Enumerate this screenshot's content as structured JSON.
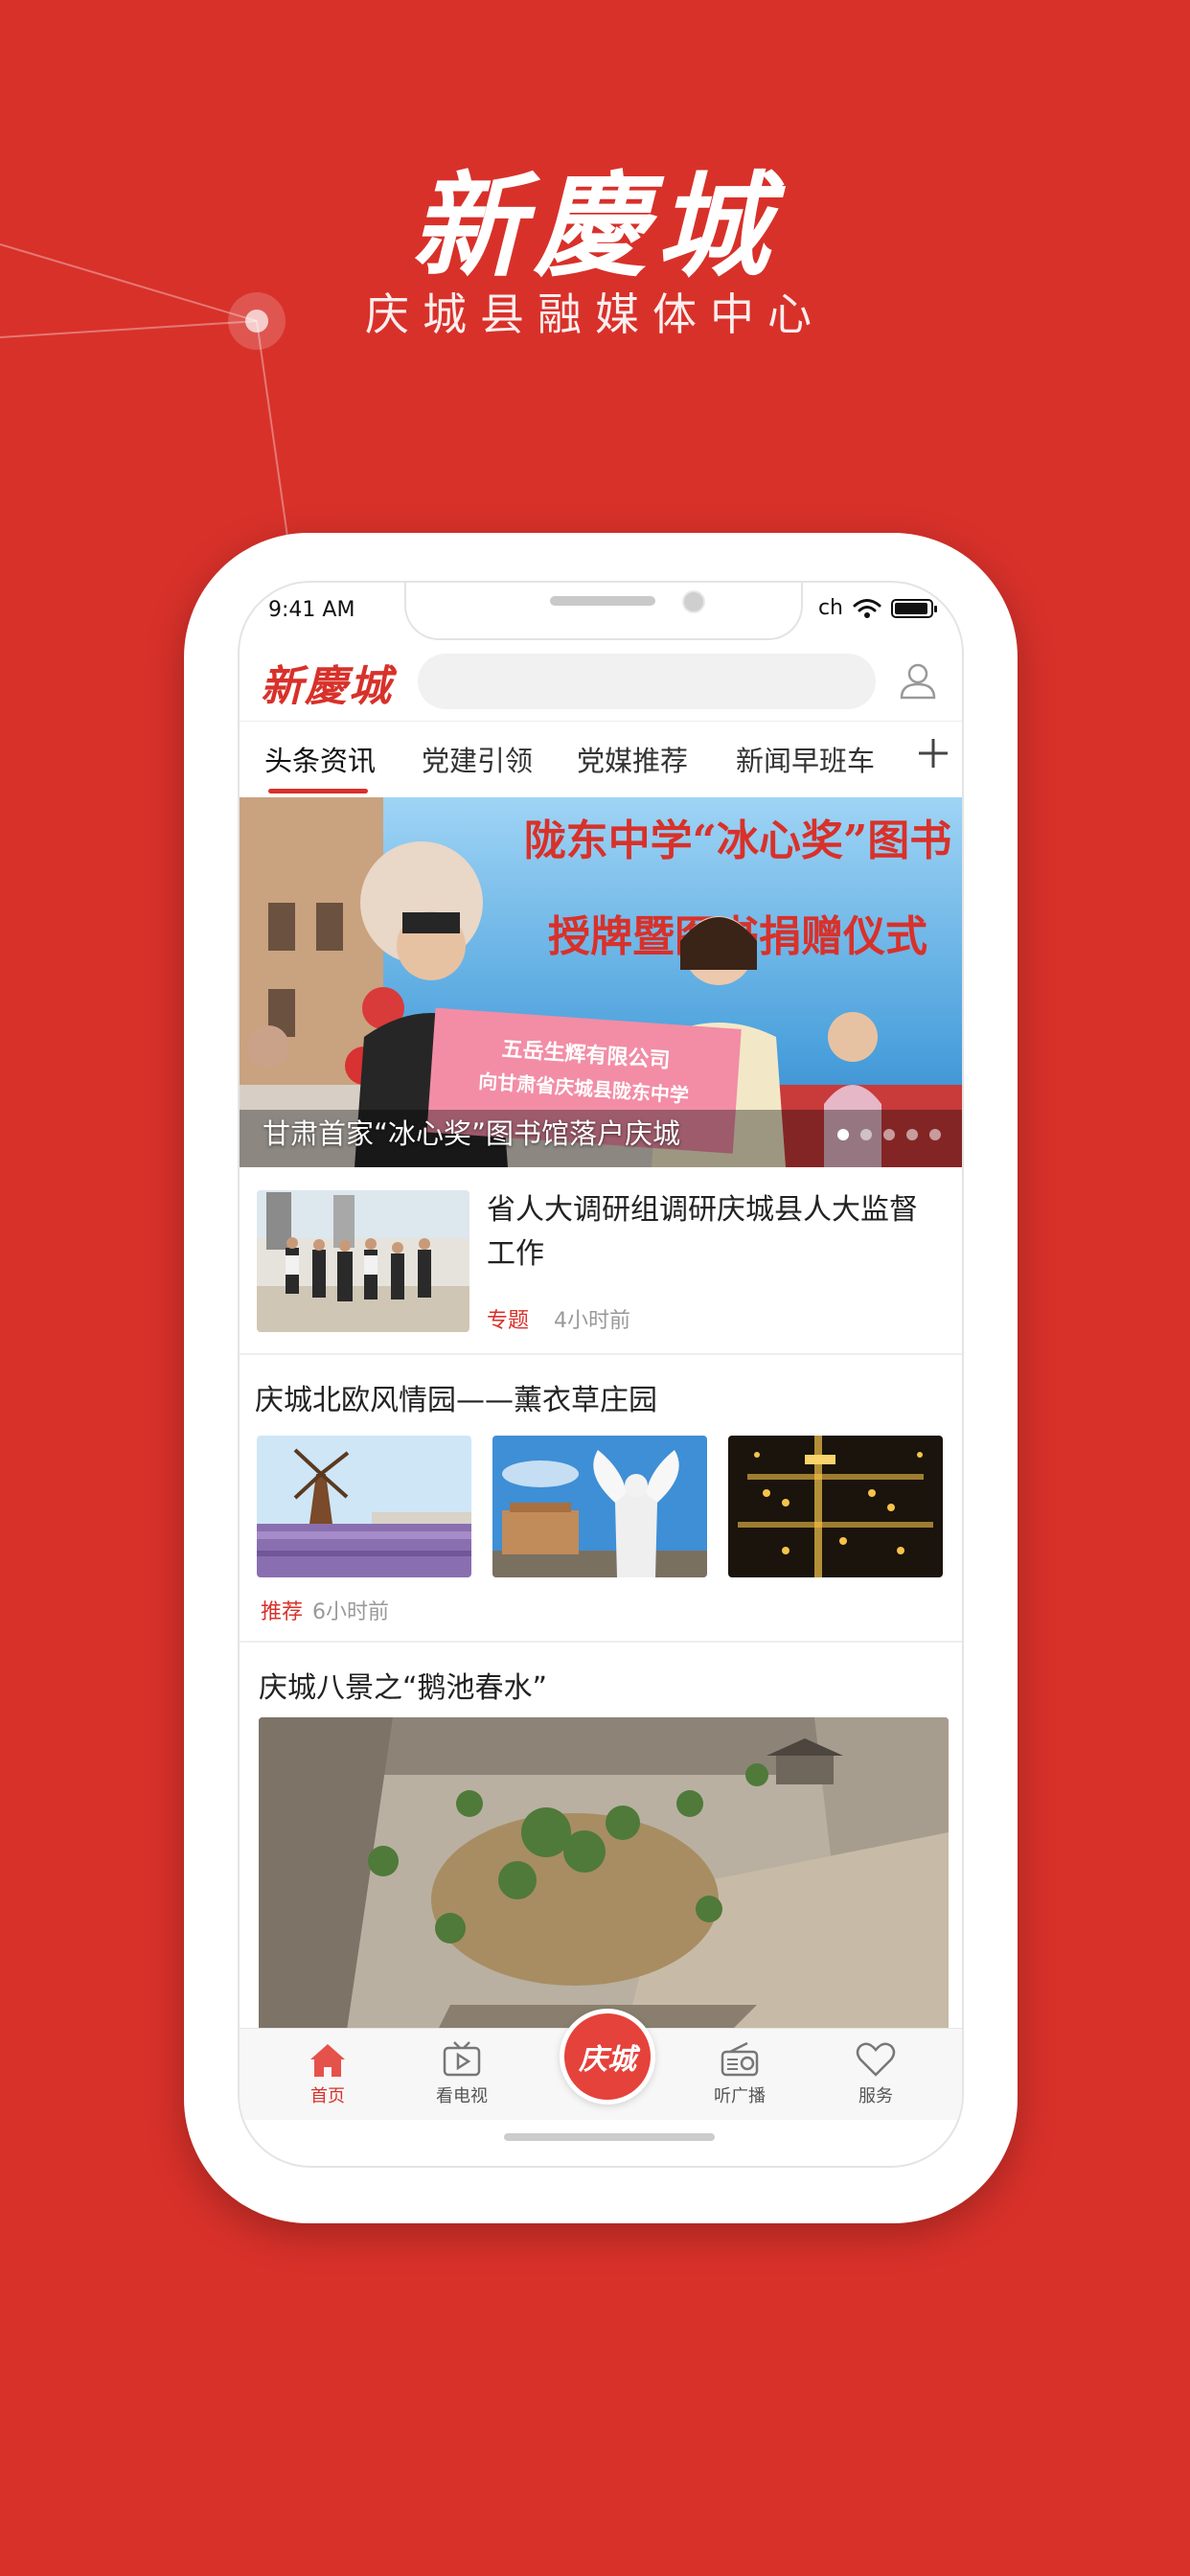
{
  "promo": {
    "logo_text": "新慶城",
    "subtitle": "庆城县融媒体中心"
  },
  "status_bar": {
    "time": "9:41 AM",
    "carrier": "ch"
  },
  "header": {
    "logo_text": "新慶城",
    "search_placeholder": ""
  },
  "tabs": [
    {
      "label": "头条资讯",
      "active": true
    },
    {
      "label": "党建引领",
      "active": false
    },
    {
      "label": "党媒推荐",
      "active": false
    },
    {
      "label": "新闻早班车",
      "active": false
    }
  ],
  "banner": {
    "caption": "甘肃首家“冰心奖”图书馆落户庆城",
    "image_text": {
      "line1": "陇东中学“冰心奖”图书",
      "line2": "授牌暨图书捐赠仪式",
      "sign1": "五岳生辉有限公司",
      "sign2": "向甘肃省庆城县陇东中学"
    },
    "dot_count": 5,
    "active_dot": 0
  },
  "news": [
    {
      "title": "省人大调研组调研庆城县人大监督工作",
      "tag": "专题",
      "time": "4小时前"
    },
    {
      "title": "庆城北欧风情园——薰衣草庄园",
      "tag": "推荐",
      "time": "6小时前"
    },
    {
      "title": "庆城八景之“鹅池春水”"
    }
  ],
  "tabbar": {
    "items": [
      {
        "label": "首页",
        "icon": "home-icon",
        "active": true
      },
      {
        "label": "看电视",
        "icon": "tv-icon",
        "active": false
      },
      {
        "label": "听广播",
        "icon": "radio-icon",
        "active": false
      },
      {
        "label": "服务",
        "icon": "heart-icon",
        "active": false
      }
    ],
    "center_label": "庆城"
  },
  "colors": {
    "brand_red": "#d8312a",
    "tag_red": "#d8312a",
    "muted_gray": "#999999"
  }
}
